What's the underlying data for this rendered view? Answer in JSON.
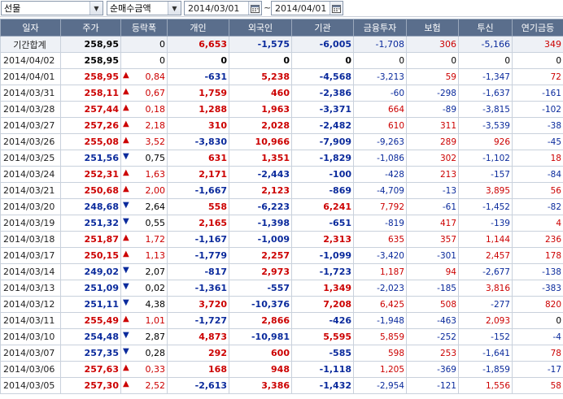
{
  "toolbar": {
    "market": "선물",
    "metric": "순매수금액",
    "date_from": "2014/03/01",
    "date_to": "2014/04/01",
    "separator": "~"
  },
  "columns": [
    "일자",
    "주가",
    "등락폭",
    "개인",
    "외국인",
    "기관",
    "금융투자",
    "보험",
    "투신",
    "연기금등"
  ],
  "summary": {
    "label": "기간합계",
    "price": "258,95",
    "change": "0",
    "individual": "6,653",
    "foreign": "-1,575",
    "institution": "-6,005",
    "fin": "-1,708",
    "insurance": "306",
    "trust": "-5,166",
    "pension": "349"
  },
  "colors": {
    "up": "#cc0000",
    "down": "#0a2a9c",
    "header_bg": "#5a6e8c"
  },
  "rows": [
    {
      "date": "2014/04/02",
      "price": "258,95",
      "dir": "none",
      "change": "0",
      "individual": "0",
      "foreign": "0",
      "institution": "0",
      "fin": "0",
      "insurance": "0",
      "trust": "0",
      "pension": "0"
    },
    {
      "date": "2014/04/01",
      "price": "258,95",
      "dir": "up",
      "change": "0,84",
      "individual": "-631",
      "foreign": "5,238",
      "institution": "-4,568",
      "fin": "-3,213",
      "insurance": "59",
      "trust": "-1,347",
      "pension": "72"
    },
    {
      "date": "2014/03/31",
      "price": "258,11",
      "dir": "up",
      "change": "0,67",
      "individual": "1,759",
      "foreign": "460",
      "institution": "-2,386",
      "fin": "-60",
      "insurance": "-298",
      "trust": "-1,637",
      "pension": "-161"
    },
    {
      "date": "2014/03/28",
      "price": "257,44",
      "dir": "up",
      "change": "0,18",
      "individual": "1,288",
      "foreign": "1,963",
      "institution": "-3,371",
      "fin": "664",
      "insurance": "-89",
      "trust": "-3,815",
      "pension": "-102"
    },
    {
      "date": "2014/03/27",
      "price": "257,26",
      "dir": "up",
      "change": "2,18",
      "individual": "310",
      "foreign": "2,028",
      "institution": "-2,482",
      "fin": "610",
      "insurance": "311",
      "trust": "-3,539",
      "pension": "-38"
    },
    {
      "date": "2014/03/26",
      "price": "255,08",
      "dir": "up",
      "change": "3,52",
      "individual": "-3,830",
      "foreign": "10,966",
      "institution": "-7,909",
      "fin": "-9,263",
      "insurance": "289",
      "trust": "926",
      "pension": "-45"
    },
    {
      "date": "2014/03/25",
      "price": "251,56",
      "dir": "down",
      "change": "0,75",
      "individual": "631",
      "foreign": "1,351",
      "institution": "-1,829",
      "fin": "-1,086",
      "insurance": "302",
      "trust": "-1,102",
      "pension": "18"
    },
    {
      "date": "2014/03/24",
      "price": "252,31",
      "dir": "up",
      "change": "1,63",
      "individual": "2,171",
      "foreign": "-2,443",
      "institution": "-100",
      "fin": "-428",
      "insurance": "213",
      "trust": "-157",
      "pension": "-84"
    },
    {
      "date": "2014/03/21",
      "price": "250,68",
      "dir": "up",
      "change": "2,00",
      "individual": "-1,667",
      "foreign": "2,123",
      "institution": "-869",
      "fin": "-4,709",
      "insurance": "-13",
      "trust": "3,895",
      "pension": "56"
    },
    {
      "date": "2014/03/20",
      "price": "248,68",
      "dir": "down",
      "change": "2,64",
      "individual": "558",
      "foreign": "-6,223",
      "institution": "6,241",
      "fin": "7,792",
      "insurance": "-61",
      "trust": "-1,452",
      "pension": "-82"
    },
    {
      "date": "2014/03/19",
      "price": "251,32",
      "dir": "down",
      "change": "0,55",
      "individual": "2,165",
      "foreign": "-1,398",
      "institution": "-651",
      "fin": "-819",
      "insurance": "417",
      "trust": "-139",
      "pension": "4"
    },
    {
      "date": "2014/03/18",
      "price": "251,87",
      "dir": "up",
      "change": "1,72",
      "individual": "-1,167",
      "foreign": "-1,009",
      "institution": "2,313",
      "fin": "635",
      "insurance": "357",
      "trust": "1,144",
      "pension": "236"
    },
    {
      "date": "2014/03/17",
      "price": "250,15",
      "dir": "up",
      "change": "1,13",
      "individual": "-1,779",
      "foreign": "2,257",
      "institution": "-1,099",
      "fin": "-3,420",
      "insurance": "-301",
      "trust": "2,457",
      "pension": "178"
    },
    {
      "date": "2014/03/14",
      "price": "249,02",
      "dir": "down",
      "change": "2,07",
      "individual": "-817",
      "foreign": "2,973",
      "institution": "-1,723",
      "fin": "1,187",
      "insurance": "94",
      "trust": "-2,677",
      "pension": "-138"
    },
    {
      "date": "2014/03/13",
      "price": "251,09",
      "dir": "down",
      "change": "0,02",
      "individual": "-1,361",
      "foreign": "-557",
      "institution": "1,349",
      "fin": "-2,023",
      "insurance": "-185",
      "trust": "3,816",
      "pension": "-383"
    },
    {
      "date": "2014/03/12",
      "price": "251,11",
      "dir": "down",
      "change": "4,38",
      "individual": "3,720",
      "foreign": "-10,376",
      "institution": "7,208",
      "fin": "6,425",
      "insurance": "508",
      "trust": "-277",
      "pension": "820"
    },
    {
      "date": "2014/03/11",
      "price": "255,49",
      "dir": "up",
      "change": "1,01",
      "individual": "-1,727",
      "foreign": "2,866",
      "institution": "-426",
      "fin": "-1,948",
      "insurance": "-463",
      "trust": "2,093",
      "pension": "0"
    },
    {
      "date": "2014/03/10",
      "price": "254,48",
      "dir": "down",
      "change": "2,87",
      "individual": "4,873",
      "foreign": "-10,981",
      "institution": "5,595",
      "fin": "5,859",
      "insurance": "-252",
      "trust": "-152",
      "pension": "-4"
    },
    {
      "date": "2014/03/07",
      "price": "257,35",
      "dir": "down",
      "change": "0,28",
      "individual": "292",
      "foreign": "600",
      "institution": "-585",
      "fin": "598",
      "insurance": "253",
      "trust": "-1,641",
      "pension": "78"
    },
    {
      "date": "2014/03/06",
      "price": "257,63",
      "dir": "up",
      "change": "0,33",
      "individual": "168",
      "foreign": "948",
      "institution": "-1,118",
      "fin": "1,205",
      "insurance": "-369",
      "trust": "-1,859",
      "pension": "-17"
    },
    {
      "date": "2014/03/05",
      "price": "257,30",
      "dir": "up",
      "change": "2,52",
      "individual": "-2,613",
      "foreign": "3,386",
      "institution": "-1,432",
      "fin": "-2,954",
      "insurance": "-121",
      "trust": "1,556",
      "pension": "58"
    }
  ]
}
